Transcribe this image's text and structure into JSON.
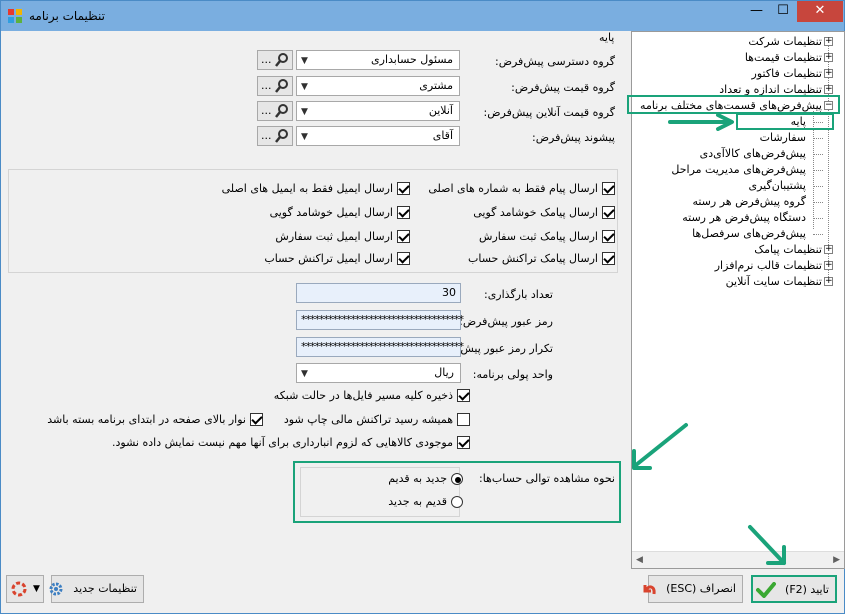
{
  "window": {
    "title": "تنظیمات برنامه",
    "min_glyph": "—",
    "max_glyph": "☐",
    "close_glyph": "✕"
  },
  "tree": {
    "items": [
      {
        "label": "تنظیمات شرکت",
        "expander": "+"
      },
      {
        "label": "تنظیمات قیمت‌ها",
        "expander": "+"
      },
      {
        "label": "تنظیمات فاکتور",
        "expander": "+"
      },
      {
        "label": "تنظیمات اندازه و تعداد",
        "expander": "+"
      },
      {
        "label": "پیش‌فرض‌های قسمت‌های مختلف برنامه",
        "expander": "−"
      },
      {
        "label": "پایه"
      },
      {
        "label": "سفارشات"
      },
      {
        "label": "پیش‌فرض‌های کالاآی‌دی"
      },
      {
        "label": "پیش‌فرض‌های مدیریت مراحل"
      },
      {
        "label": "پشتیبان‌گیری"
      },
      {
        "label": "گروه پیش‌فرض هر رسته"
      },
      {
        "label": "دستگاه پیش‌فرض هر رسته"
      },
      {
        "label": "پیش‌فرض‌های سرفصل‌ها"
      },
      {
        "label": "تنظیمات پیامک",
        "expander": "+"
      },
      {
        "label": "تنظیمات قالب نرم‌افزار",
        "expander": "+"
      },
      {
        "label": "تنظیمات سایت آنلاین",
        "expander": "+"
      }
    ]
  },
  "main": {
    "group_title": "پایه",
    "lookup_dots": "...",
    "defaults": [
      {
        "label": "گروه دسترسی پیش‌فرض:",
        "value": "مسئول حسابداری"
      },
      {
        "label": "گروه قیمت پیش‌فرض:",
        "value": "مشتری"
      },
      {
        "label": "گروه قیمت آنلاین پیش‌فرض:",
        "value": "آنلاین"
      },
      {
        "label": "پیشوند پیش‌فرض:",
        "value": "آقای"
      }
    ],
    "checks_right": [
      {
        "label": "ارسال پیام فقط به شماره های اصلی",
        "checked": true
      },
      {
        "label": "ارسال پیامک خوشامد گویی",
        "checked": true
      },
      {
        "label": "ارسال پیامک ثبت سفارش",
        "checked": true
      },
      {
        "label": "ارسال پیامک تراکنش حساب",
        "checked": true
      }
    ],
    "checks_left": [
      {
        "label": "ارسال ایمیل فقط به ایمیل های اصلی",
        "checked": true
      },
      {
        "label": "ارسال ایمیل خوشامد گویی",
        "checked": true
      },
      {
        "label": "ارسال ایمیل ثبت سفارش",
        "checked": true
      },
      {
        "label": "ارسال ایمیل تراکنش حساب",
        "checked": true
      }
    ],
    "reload_label": "تعداد بارگذاری:",
    "reload_value": "30",
    "password_label": "رمز عبور پیش‌فرض:",
    "password_value": "************************************",
    "password_repeat_label": "تکرار رمز عبور پیش‌فرض:",
    "password_repeat_value": "************************************",
    "currency_label": "واحد پولی برنامه:",
    "currency_value": "ریال",
    "options": [
      {
        "label": "ذخیره کلیه مسیر فایل‌ها در حالت شبکه",
        "checked": true
      },
      {
        "label": "همیشه رسید تراکنش مالی چاپ شود",
        "checked": false
      },
      {
        "label": "نوار بالای صفحه در ابتدای برنامه بسته باشد",
        "checked": true
      },
      {
        "label": "موجودی کالاهایی که لزوم انبارداری برای آنها مهم نیست نمایش داده نشود.",
        "checked": true
      }
    ],
    "view_order_label": "نحوه مشاهده توالی حساب‌ها:",
    "view_order_options": [
      {
        "label": "جدید به قدیم",
        "selected": true
      },
      {
        "label": "قدیم به جدید",
        "selected": false
      }
    ]
  },
  "footer": {
    "ok_label": "تایید (F2)",
    "cancel_label": "انصراف (ESC)",
    "new_settings_label": "تنظیمات جدید"
  },
  "colors": {
    "accent": "#1aa37a",
    "titlebar": "#7aaee0",
    "close": "#c7463d"
  }
}
